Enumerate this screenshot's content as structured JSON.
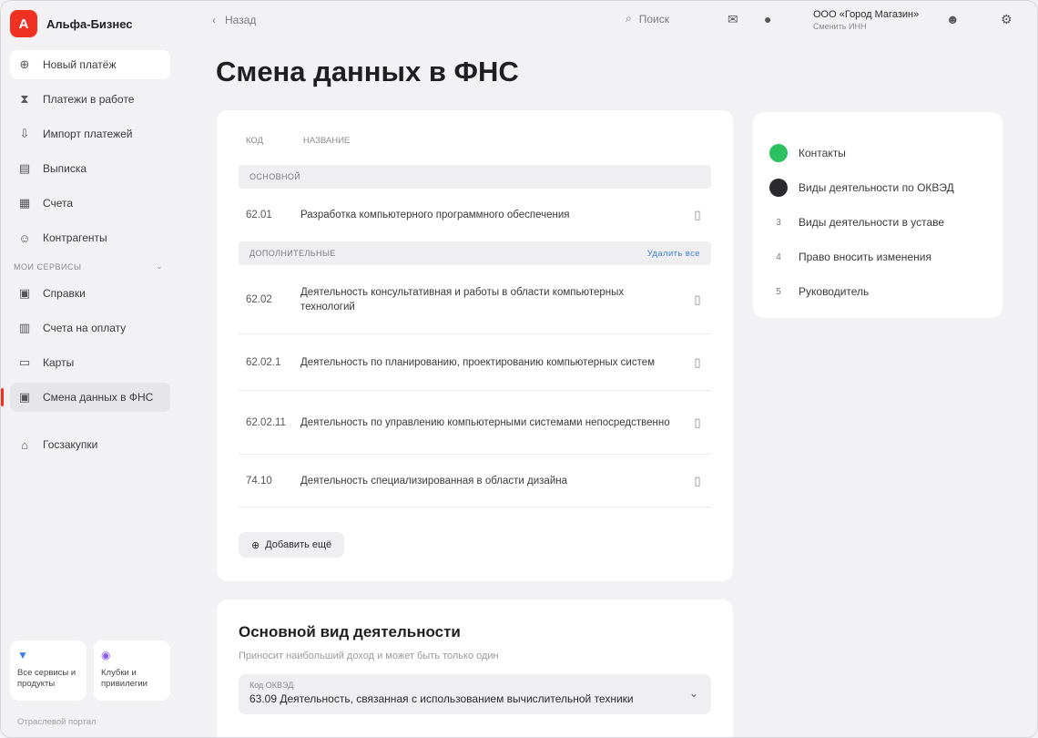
{
  "brand": {
    "logo_letter": "А",
    "name": "Альфа-Бизнес"
  },
  "sidebar": {
    "items": [
      {
        "label": "Новый платёж",
        "icon": "plus-circle-icon",
        "glyph": "⊕"
      },
      {
        "label": "Платежи в работе",
        "icon": "hourglass-icon",
        "glyph": "⧗"
      },
      {
        "label": "Импорт платежей",
        "icon": "import-icon",
        "glyph": "⇩"
      },
      {
        "label": "Выписка",
        "icon": "document-icon",
        "glyph": "▤"
      },
      {
        "label": "Счета",
        "icon": "accounts-icon",
        "glyph": "▦"
      },
      {
        "label": "Контрагенты",
        "icon": "contacts-icon",
        "glyph": "☺"
      }
    ],
    "section_title": "мои сервисы",
    "service_items": [
      {
        "label": "Справки",
        "icon": "certificate-icon",
        "glyph": "▣"
      },
      {
        "label": "Счета на оплату",
        "icon": "invoice-icon",
        "glyph": "▥"
      },
      {
        "label": "Карты",
        "icon": "card-icon",
        "glyph": "▭"
      },
      {
        "label": "Смена данных в ФНС",
        "icon": "fns-icon",
        "glyph": "▣"
      }
    ],
    "extra_item": {
      "label": "Госзакупки",
      "icon": "procurement-icon",
      "glyph": "⌂"
    },
    "cards": [
      {
        "label": "Все сервисы и продукты",
        "icon": "grid-icon",
        "glyph": "▼",
        "color": "#3b7fe0"
      },
      {
        "label": "Клубки и привилегии",
        "icon": "star-icon",
        "glyph": "◉",
        "color": "#8a5cf6"
      }
    ],
    "footer": "Отраслевой портал"
  },
  "topbar": {
    "back_label": "Назад",
    "search_label": "Поиск",
    "company_name": "ООО «Город Магазин»",
    "company_sub": "Сменить ИНН"
  },
  "page_title": "Смена данных в ФНС",
  "table": {
    "col_code": "код",
    "col_name": "название",
    "main_group": "основной",
    "main_rows": [
      {
        "code": "62.01",
        "name": "Разработка компьютерного программного обеспечения"
      }
    ],
    "extra_group": "дополнительные",
    "extra_link": "Удалить все",
    "extra_rows": [
      {
        "code": "62.02",
        "name": "Деятельность консультативная и работы в области компьютерных технологий"
      },
      {
        "code": "62.02.1",
        "name": "Деятельность по планированию, проектированию компьютерных систем"
      },
      {
        "code": "62.02.11",
        "name": "Деятельность по управлению компьютерными системами непосредственно"
      },
      {
        "code": "74.10",
        "name": "Деятельность специализированная в области дизайна"
      }
    ],
    "add_button": "Добавить ещё"
  },
  "okved": {
    "title": "Основной вид деятельности",
    "subtitle": "Приносит наибольший доход и может быть только один",
    "select_label": "Код ОКВЭД",
    "select_value": "63.09 Деятельность, связанная с использованием вычислительной техники"
  },
  "steps": [
    {
      "label": "Контакты",
      "state": "done"
    },
    {
      "label": "Виды деятельности по ОКВЭД",
      "state": "current"
    },
    {
      "label": "Виды деятельности в уставе",
      "state": "todo",
      "num": "3"
    },
    {
      "label": "Право вносить изменения",
      "state": "todo",
      "num": "4"
    },
    {
      "label": "Руководитель",
      "state": "todo",
      "num": "5"
    }
  ],
  "colors": {
    "brand": "#ef3124",
    "done": "#2bc160",
    "link": "#3b7fe0"
  }
}
